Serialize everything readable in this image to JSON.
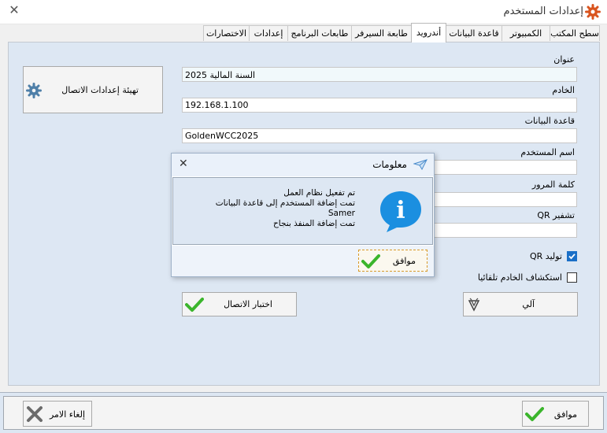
{
  "window": {
    "title": "إعدادات المستخدم",
    "close_glyph": "✕"
  },
  "tabs": [
    {
      "label": "سطح المكتب"
    },
    {
      "label": "الكمبيوتر"
    },
    {
      "label": "قاعدة البيانات"
    },
    {
      "label": "أندرويد"
    },
    {
      "label": "طابعة السيرفر"
    },
    {
      "label": "طابعات البرنامج"
    },
    {
      "label": "إعدادات"
    },
    {
      "label": "الاختصارات"
    }
  ],
  "form": {
    "address_label": "عنوان",
    "address_value": "السنة المالية 2025",
    "server_label": "الخادم",
    "server_value": "192.168.1.100",
    "database_label": "قاعدة البيانات",
    "database_value": "GoldenWCC2025",
    "username_label": "اسم المستخدم",
    "username_value": "",
    "password_label": "كلمة المرور",
    "password_value": "",
    "qr_encrypt_label": "تشفير QR",
    "qr_encrypt_value": "",
    "qr_generate_label": "توليد QR",
    "qr_generate_checked": true,
    "auto_discover_label": "استكشاف الخادم تلقائيا",
    "auto_discover_checked": false
  },
  "buttons": {
    "setup_connection": "تهيئة إعدادات الاتصال",
    "test_connection": "اختبار الاتصال",
    "auto": "آلي",
    "ok": "موافق",
    "cancel": "إلغاء الامر"
  },
  "dialog": {
    "title": "معلومات",
    "messages": [
      "تم تفعيل نظام العمل",
      "تمت إضافة المستخدم إلى قاعدة البيانات",
      "Samer",
      "تمت إضافة المنفذ بنجاح"
    ],
    "ok_label": "موافق",
    "close_glyph": "✕",
    "info_glyph": "i"
  },
  "colors": {
    "accent": "#1a6fc7",
    "panel": "#dde7f3",
    "ok_green": "#3bb52c",
    "cancel_gray": "#6b6b6b",
    "title_gear": "#d9541e"
  }
}
